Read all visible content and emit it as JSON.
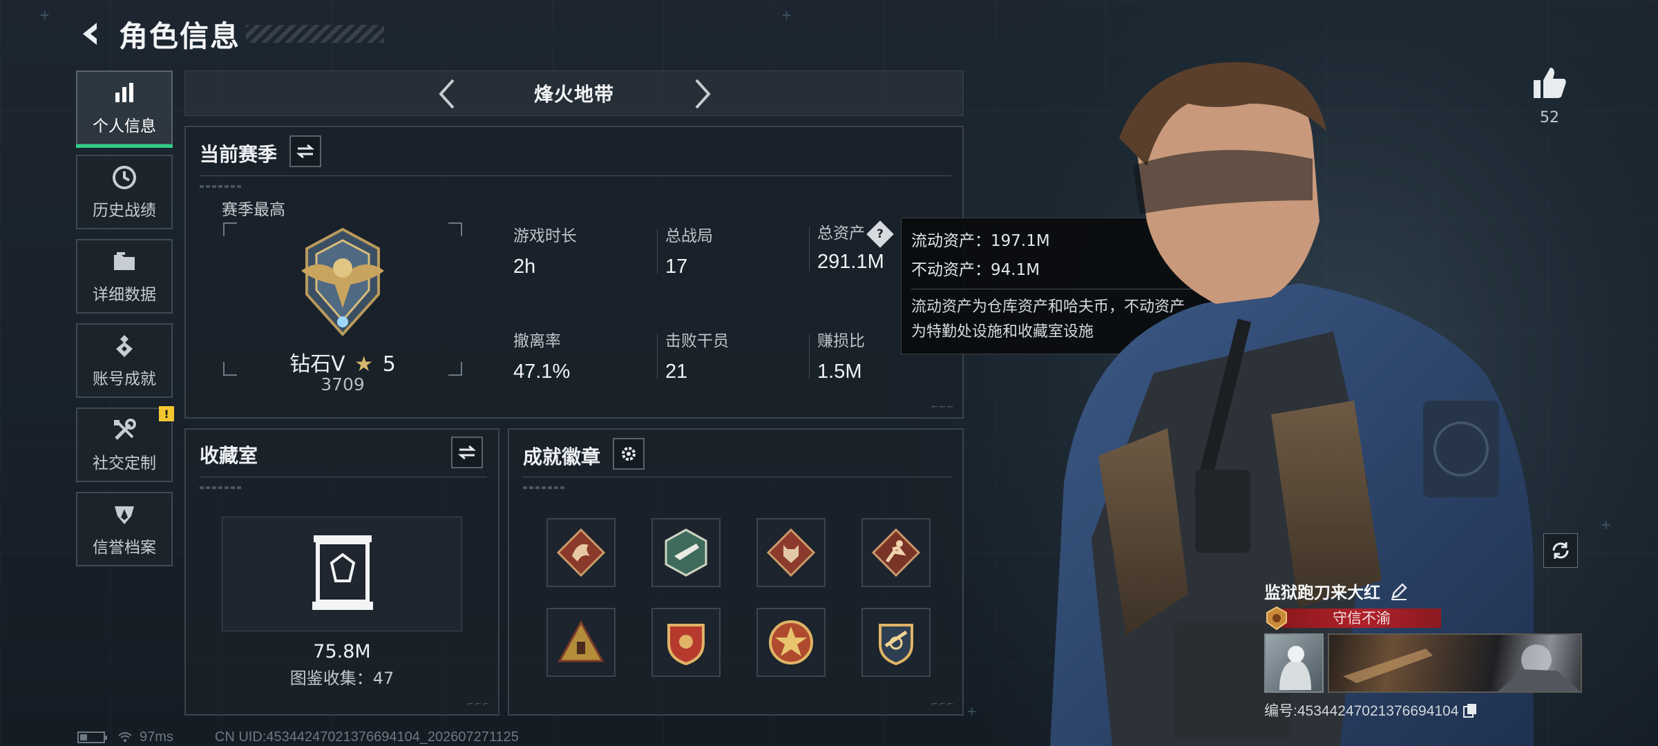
{
  "header": {
    "title": "角色信息"
  },
  "sidebar": {
    "items": [
      {
        "label": "个人信息",
        "icon": "bar-chart-icon",
        "active": true
      },
      {
        "label": "历史战绩",
        "icon": "clock-icon"
      },
      {
        "label": "详细数据",
        "icon": "folder-icon"
      },
      {
        "label": "账号成就",
        "icon": "achievement-icon"
      },
      {
        "label": "社交定制",
        "icon": "tools-icon",
        "alert": "!"
      },
      {
        "label": "信誉档案",
        "icon": "shield-icon"
      }
    ]
  },
  "mode": {
    "title": "烽火地带"
  },
  "season": {
    "title": "当前赛季",
    "best_label": "赛季最高",
    "rank_name": "钻石V",
    "rank_stars": "5",
    "rank_score": "3709",
    "stats": [
      {
        "label": "游戏时长",
        "value": "2h"
      },
      {
        "label": "总战局",
        "value": "17"
      },
      {
        "label": "总资产",
        "value": "291.1M"
      },
      {
        "label": "撤离率",
        "value": "47.1%"
      },
      {
        "label": "击败干员",
        "value": "21"
      },
      {
        "label": "赚损比",
        "value": "1.5M"
      }
    ]
  },
  "tooltip": {
    "liquid": "流动资产：197.1M",
    "fixed": "不动资产：94.1M",
    "desc_line1": "流动资产为仓库资产和哈夫币，不动资产",
    "desc_line2": "为特勤处设施和收藏室设施"
  },
  "collection": {
    "title": "收藏室",
    "value": "75.8M",
    "count": "图鉴收集：47"
  },
  "badges": {
    "title": "成就徽章",
    "items": [
      "dragon-badge",
      "gun-badge",
      "wolf-badge",
      "runner-badge",
      "pyramid-badge",
      "shield-badge",
      "star-badge",
      "rifle-badge"
    ]
  },
  "player": {
    "likes": "52",
    "name": "监狱跑刀来大红",
    "title": "守信不渝",
    "id": "编号:4534424702137669410​4"
  },
  "status": {
    "ping": "97ms",
    "uid": "CN UID:4534424702137669410​4_202607271125"
  },
  "colors": {
    "accent": "#2fcf87",
    "title_banner": "#b0212a",
    "alert": "#f2c631"
  }
}
